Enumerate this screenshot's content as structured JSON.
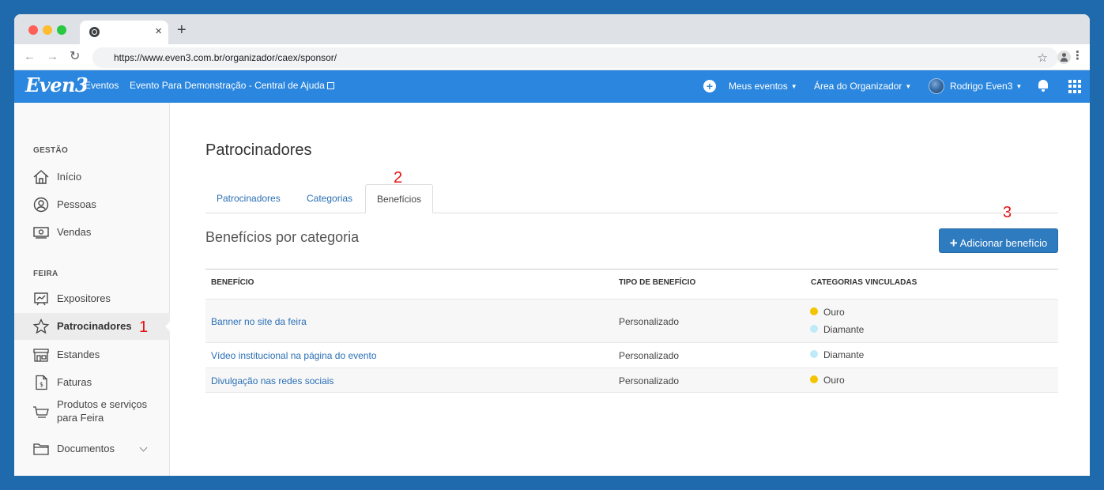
{
  "browser": {
    "url": "https://www.even3.com.br/organizador/caex/sponsor/",
    "new_tab": "+",
    "close_tab": "×"
  },
  "header": {
    "logo": "Even3",
    "brand_tag": "Eventos",
    "event_link": "Evento Para Demonstração - Central de Ajuda",
    "my_events": "Meus eventos",
    "organizer_area": "Área do Organizador",
    "user_name": "Rodrigo Even3"
  },
  "sidebar": {
    "sections": [
      {
        "title": "GESTÃO",
        "items": [
          {
            "label": "Início",
            "icon": "home-icon"
          },
          {
            "label": "Pessoas",
            "icon": "user-icon"
          },
          {
            "label": "Vendas",
            "icon": "cash-icon"
          }
        ]
      },
      {
        "title": "FEIRA",
        "items": [
          {
            "label": "Expositores",
            "icon": "board-icon"
          },
          {
            "label": "Patrocinadores",
            "icon": "star-icon",
            "active": true
          },
          {
            "label": "Estandes",
            "icon": "store-icon"
          },
          {
            "label": "Faturas",
            "icon": "invoice-icon"
          },
          {
            "label": "Produtos e serviços para Feira",
            "icon": "cart-icon"
          },
          {
            "label": "Documentos",
            "icon": "folder-icon"
          }
        ]
      }
    ]
  },
  "main": {
    "title": "Patrocinadores",
    "tabs": [
      {
        "label": "Patrocinadores"
      },
      {
        "label": "Categorias"
      },
      {
        "label": "Benefícios",
        "active": true
      }
    ],
    "subtitle": "Benefícios por categoria",
    "add_button": "Adicionar benefício",
    "table": {
      "headers": [
        "BENEFÍCIO",
        "TIPO DE BENEFÍCIO",
        "CATEGORIAS VINCULADAS"
      ],
      "rows": [
        {
          "benefit": "Banner no site da feira",
          "type": "Personalizado",
          "categories": [
            "Ouro",
            "Diamante"
          ]
        },
        {
          "benefit": "Vídeo institucional na página do evento",
          "type": "Personalizado",
          "categories": [
            "Diamante"
          ]
        },
        {
          "benefit": "Divulgação nas redes sociais",
          "type": "Personalizado",
          "categories": [
            "Ouro"
          ]
        }
      ]
    }
  },
  "category_colors": {
    "Ouro": "#f5c400",
    "Diamante": "#bfeaf7"
  },
  "annotations": {
    "sidebar": "1",
    "tab": "2",
    "button": "3"
  },
  "colors": {
    "brand": "#2a86de",
    "page_background": "#1e6aad",
    "button": "#2f7bbf",
    "link": "#2a6fb5"
  }
}
